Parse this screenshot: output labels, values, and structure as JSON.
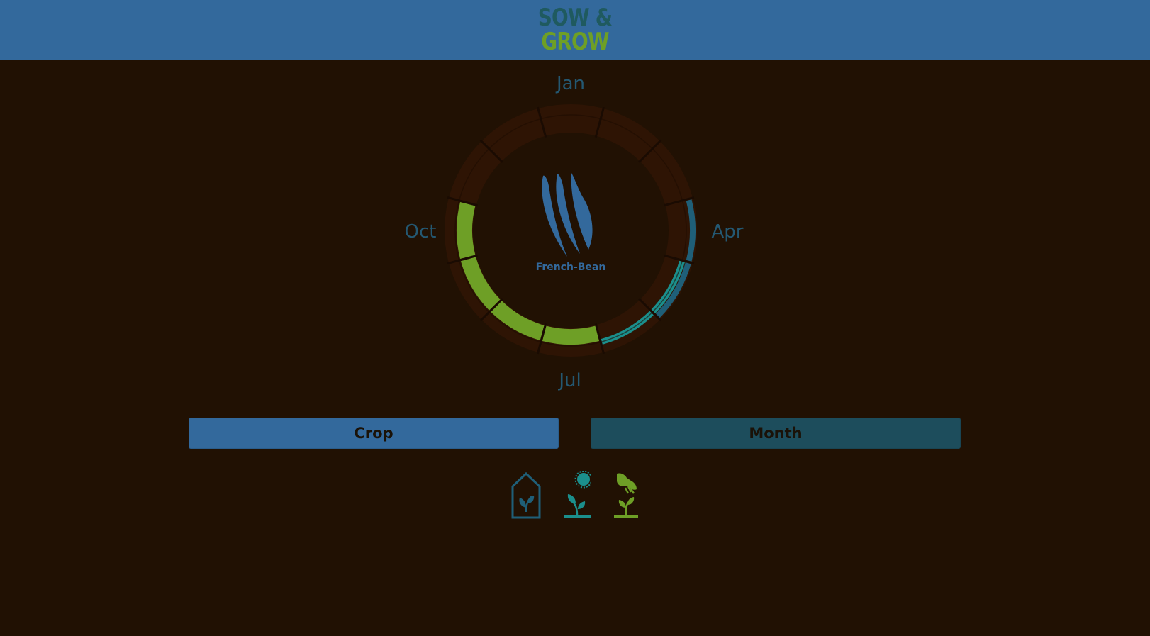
{
  "header": {
    "logo_line1": "SOW &",
    "logo_line2": "GROW"
  },
  "wheel": {
    "months_shown": {
      "top": "Jan",
      "right": "Apr",
      "bottom": "Jul",
      "left": "Oct"
    },
    "crop_name": "French-Bean",
    "crop_icon": "french-bean-icon",
    "schedule": {
      "sow_indoors": [
        "Apr",
        "May"
      ],
      "sow_outdoors": [
        "May",
        "Jun"
      ],
      "harvest": [
        "Jul",
        "Aug",
        "Sep",
        "Oct"
      ]
    }
  },
  "buttons": {
    "crop_label": "Crop",
    "month_label": "Month"
  },
  "legend": [
    {
      "icon": "greenhouse-seedling-icon",
      "meaning": "sow indoors"
    },
    {
      "icon": "sun-seedling-icon",
      "meaning": "sow outdoors"
    },
    {
      "icon": "hand-harvest-icon",
      "meaning": "harvest"
    }
  ],
  "colors": {
    "header": "#33699c",
    "background": "#211103",
    "sow_indoors": "#1f5f78",
    "sow_outdoors": "#1b8f8c",
    "harvest": "#6e9f26",
    "ring_empty": "#2e1404"
  }
}
